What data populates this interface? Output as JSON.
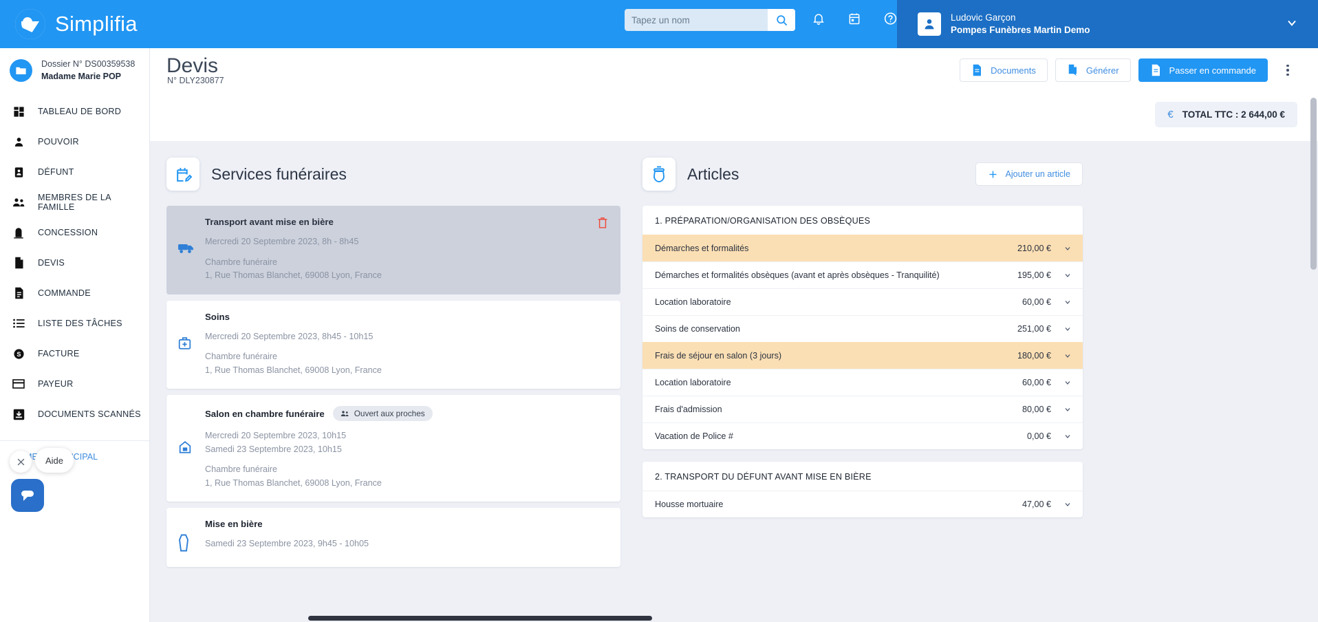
{
  "topbar": {
    "brand": "Simplifia",
    "search_placeholder": "Tapez un nom",
    "search_value": "",
    "icons": [
      "search-icon",
      "bell-icon",
      "calendar-icon",
      "help-icon"
    ],
    "user": {
      "name": "Ludovic Garçon",
      "org": "Pompes Funèbres Martin Demo"
    },
    "accent": "#2196f3",
    "user_box_color": "#1c6fc4"
  },
  "sidebar": {
    "dossier_label": "Dossier N° DS00359538",
    "dossier_name": "Madame Marie POP",
    "items": [
      {
        "label": "TABLEAU DE BORD",
        "icon": "dashboard-icon"
      },
      {
        "label": "POUVOIR",
        "icon": "person-icon"
      },
      {
        "label": "DÉFUNT",
        "icon": "badge-person-icon"
      },
      {
        "label": "MEMBRES DE LA FAMILLE",
        "icon": "group-icon"
      },
      {
        "label": "CONCESSION",
        "icon": "tombstone-icon"
      },
      {
        "label": "DEVIS",
        "icon": "document-icon"
      },
      {
        "label": "COMMANDE",
        "icon": "document-lines-icon"
      },
      {
        "label": "LISTE DES TÂCHES",
        "icon": "list-icon"
      },
      {
        "label": "FACTURE",
        "icon": "dollar-circle-icon"
      },
      {
        "label": "PAYEUR",
        "icon": "credit-card-icon"
      },
      {
        "label": "DOCUMENTS SCANNÉS",
        "icon": "scan-download-icon"
      }
    ],
    "menu_principal": "MENU PRINCIPAL"
  },
  "chat": {
    "label": "Aide",
    "close_icon": "close-icon",
    "bubble_icon": "chat-bubble-icon"
  },
  "page": {
    "title": "Devis",
    "subtitle": "N° DLY230877",
    "buttons": [
      {
        "label": "Documents",
        "icon": "document-icon",
        "style": "outline"
      },
      {
        "label": "Générer",
        "icon": "document-generate-icon",
        "style": "outline"
      },
      {
        "label": "Passer en commande",
        "icon": "document-icon",
        "style": "primary"
      }
    ],
    "kebab": "more-options-icon",
    "total_label": "TOTAL TTC : 2 644,00 €",
    "total_currency_icon": "euro-icon"
  },
  "services_panel": {
    "title": "Services funéraires",
    "icon": "calendar-edit-icon",
    "cards": [
      {
        "name": "Transport avant mise en bière",
        "icon": "van-icon",
        "selected": true,
        "delete_icon": "trash-icon",
        "dates": [
          "Mercredi 20 Septembre 2023, 8h - 8h45"
        ],
        "place": "Chambre funéraire",
        "address": "1, Rue Thomas Blanchet, 69008 Lyon, France",
        "tag": ""
      },
      {
        "name": "Soins",
        "icon": "medical-kit-icon",
        "selected": false,
        "delete_icon": "",
        "dates": [
          "Mercredi 20 Septembre 2023, 8h45 - 10h15"
        ],
        "place": "Chambre funéraire",
        "address": "1, Rue Thomas Blanchet, 69008 Lyon, France",
        "tag": ""
      },
      {
        "name": "Salon en chambre funéraire",
        "icon": "home-funeral-icon",
        "selected": false,
        "delete_icon": "",
        "dates": [
          "Mercredi 20 Septembre 2023, 10h15",
          "Samedi 23 Septembre 2023, 10h15"
        ],
        "place": "Chambre funéraire",
        "address": "1, Rue Thomas Blanchet, 69008 Lyon, France",
        "tag": "Ouvert aux proches"
      },
      {
        "name": "Mise en bière",
        "icon": "coffin-icon",
        "selected": false,
        "delete_icon": "",
        "dates": [
          "Samedi 23 Septembre 2023, 9h45 - 10h05"
        ],
        "place": "",
        "address": "",
        "tag": ""
      }
    ]
  },
  "articles_panel": {
    "title": "Articles",
    "icon": "urn-icon",
    "add_button": "Ajouter un article",
    "add_icon": "plus-icon",
    "sections": [
      {
        "title": "1. PRÉPARATION/ORGANISATION DES OBSÈQUES",
        "rows": [
          {
            "name": "Démarches et formalités",
            "price": "210,00 €",
            "highlight": true
          },
          {
            "name": "Démarches et formalités obsèques (avant et après obsèques - Tranquilité)",
            "price": "195,00 €",
            "highlight": false
          },
          {
            "name": "Location laboratoire",
            "price": "60,00 €",
            "highlight": false
          },
          {
            "name": "Soins de conservation",
            "price": "251,00 €",
            "highlight": false
          },
          {
            "name": "Frais de séjour en salon (3 jours)",
            "price": "180,00 €",
            "highlight": true
          },
          {
            "name": "Location laboratoire",
            "price": "60,00 €",
            "highlight": false
          },
          {
            "name": "Frais d'admission",
            "price": "80,00 €",
            "highlight": false
          },
          {
            "name": "Vacation de Police #",
            "price": "0,00 €",
            "highlight": false
          }
        ]
      },
      {
        "title": "2. TRANSPORT DU DÉFUNT AVANT MISE EN BIÈRE",
        "rows": [
          {
            "name": "Housse mortuaire",
            "price": "47,00 €",
            "highlight": false
          }
        ]
      }
    ],
    "highlight_color": "#fbdfb4"
  }
}
